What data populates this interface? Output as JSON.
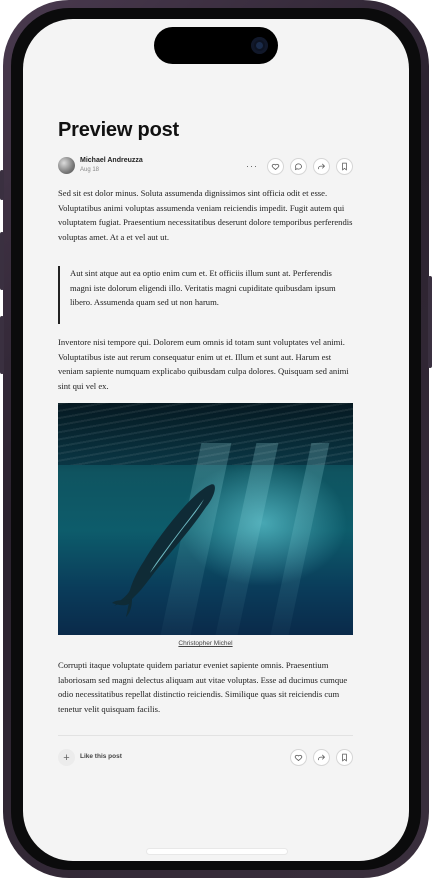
{
  "post": {
    "title": "Preview post",
    "author": "Michael Andreuzza",
    "date": "Aug 18",
    "paragraph1": "Sed sit est dolor minus. Soluta assumenda dignissimos sint officia odit et esse. Voluptatibus animi voluptas assumenda veniam reiciendis impedit. Fugit autem qui voluptatem fugiat. Praesentium necessitatibus deserunt dolore temporibus perferendis voluptas amet. At a et vel aut ut.",
    "quote": "Aut sint atque aut ea optio enim cum et. Et officiis illum sunt at. Perferendis magni iste dolorum eligendi illo. Veritatis magni cupiditate quibusdam ipsum libero. Assumenda quam sed ut non harum.",
    "paragraph2": "Inventore nisi tempore qui. Dolorem eum omnis id totam sunt voluptates vel animi. Voluptatibus iste aut rerum consequatur enim ut et. Illum et sunt aut. Harum est veniam sapiente numquam explicabo quibusdam culpa dolores. Quisquam sed animi sint qui vel ex.",
    "image_caption": "Christopher Michel",
    "paragraph3": "Corrupti itaque voluptate quidem pariatur eveniet sapiente omnis. Praesentium laboriosam sed magni delectus aliquam aut vitae voluptas. Esse ad ducimus cumque odio necessitatibus repellat distinctio reiciendis. Similique quas sit reiciendis cum tenetur velit quisquam facilis.",
    "like_label": "Like this post",
    "more_label": "···"
  },
  "icons": {
    "more": "more-icon",
    "heart": "heart-icon",
    "comment": "comment-icon",
    "share": "share-icon",
    "bookmark": "bookmark-icon",
    "plus": "plus-icon"
  },
  "colors": {
    "screen_bg": "#f4f4f4",
    "text": "#222222",
    "frame": "#3a2f3d"
  }
}
